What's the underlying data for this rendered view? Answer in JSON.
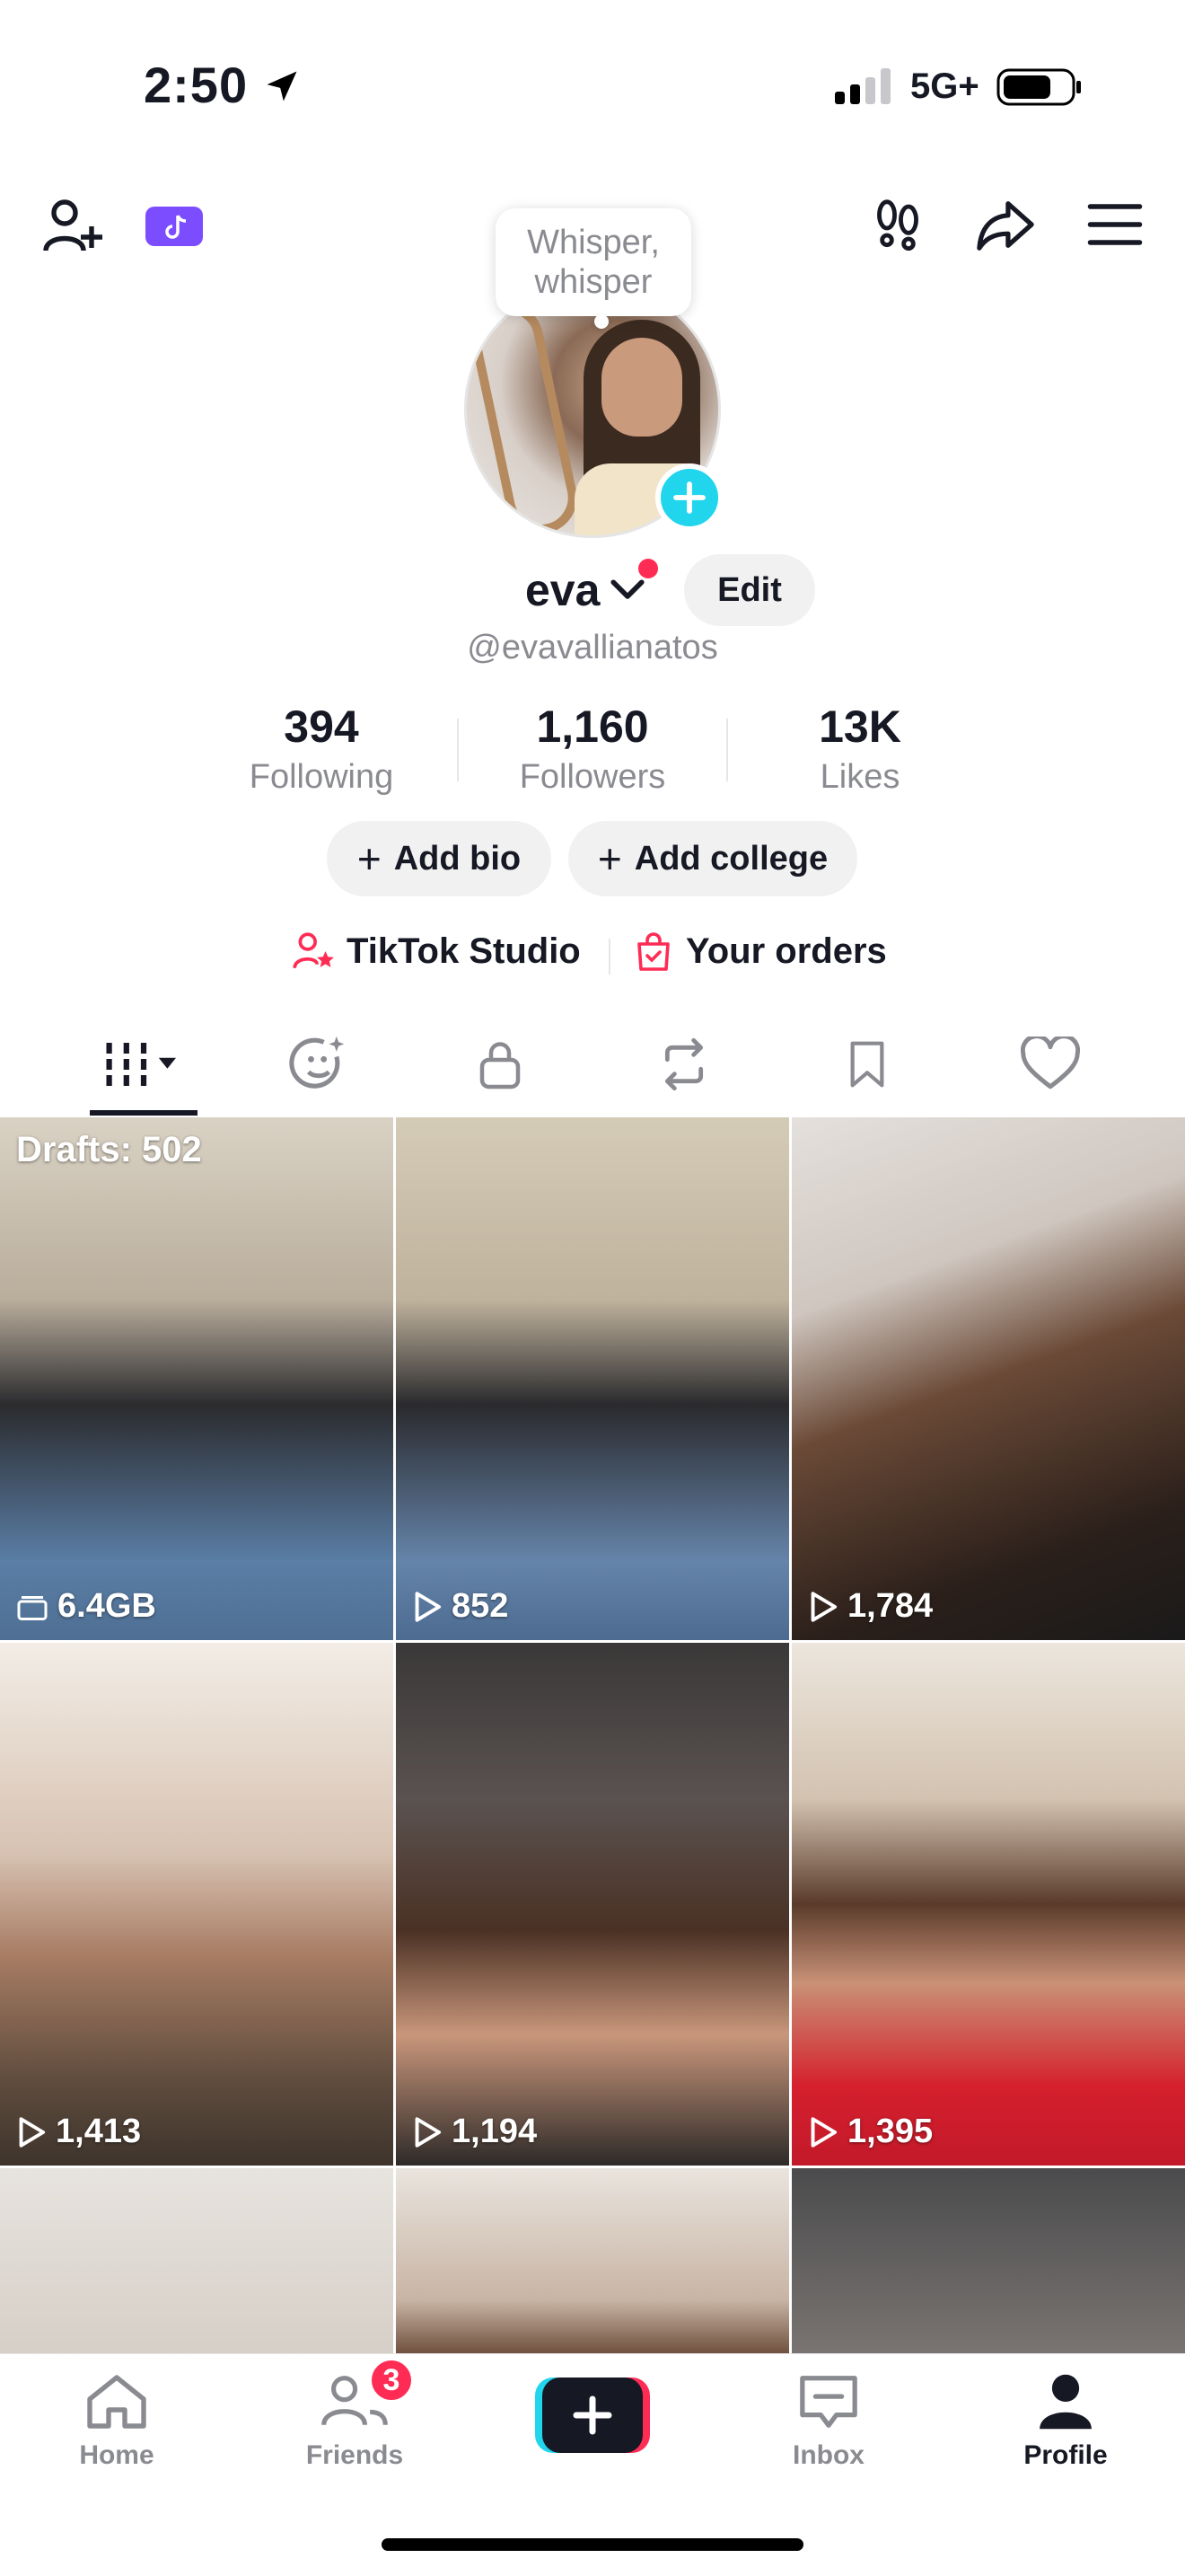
{
  "status_bar": {
    "time": "2:50",
    "network": "5G+"
  },
  "profile_tooltip": "Whisper, whisper",
  "profile": {
    "display_name": "eva",
    "edit_label": "Edit",
    "handle": "@evavallianatos",
    "stats": [
      {
        "value": "394",
        "label": "Following"
      },
      {
        "value": "1,160",
        "label": "Followers"
      },
      {
        "value": "13K",
        "label": "Likes"
      }
    ],
    "add_bio": "Add bio",
    "add_college": "Add college",
    "tiktok_studio": "TikTok Studio",
    "your_orders": "Your orders"
  },
  "tabs": [
    {
      "icon": "grid-icon",
      "active": true
    },
    {
      "icon": "repost-face-icon"
    },
    {
      "icon": "lock-icon"
    },
    {
      "icon": "repost-icon"
    },
    {
      "icon": "bookmark-icon"
    },
    {
      "icon": "heart-icon"
    }
  ],
  "grid": {
    "drafts_label": "Drafts: 502",
    "tiles": [
      {
        "label": "6.4GB",
        "icon": "drafts-icon"
      },
      {
        "label": "852",
        "icon": "play-icon"
      },
      {
        "label": "1,784",
        "icon": "play-icon"
      },
      {
        "label": "1,413",
        "icon": "play-icon"
      },
      {
        "label": "1,194",
        "icon": "play-icon"
      },
      {
        "label": "1,395",
        "icon": "play-icon"
      }
    ]
  },
  "bottom_nav": {
    "home": "Home",
    "friends": "Friends",
    "friends_badge": "3",
    "inbox": "Inbox",
    "profile": "Profile"
  },
  "colors": {
    "accent_red": "#fe2c55",
    "accent_cyan": "#20d5ec",
    "text_secondary": "#8a8b91"
  }
}
